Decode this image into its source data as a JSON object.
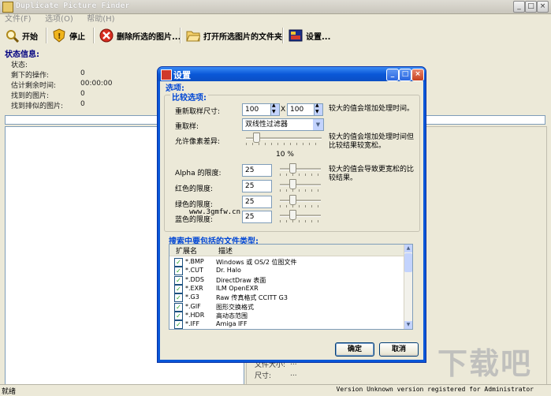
{
  "main": {
    "title": "Duplicate Picture Finder",
    "menu": [
      "文件(F)",
      "选项(O)",
      "帮助(H)"
    ],
    "toolbar": {
      "start": "开始",
      "stop": "停止",
      "delete_selected": "删除所选的图片...",
      "open_folder": "打开所选图片的文件夹",
      "settings": "设置..."
    },
    "status": {
      "header": "状态信息:",
      "rows": [
        {
          "label": "状态:",
          "value": ""
        },
        {
          "label": "剩下的操作:",
          "value": "0"
        },
        {
          "label": "估计剩余时间:",
          "value": "00:00:00"
        },
        {
          "label": "找到的图片:",
          "value": "0"
        },
        {
          "label": "找到排似的图片:",
          "value": "0"
        }
      ]
    },
    "right_pane": {
      "file_size_label": "文件大小:",
      "file_size_value": "...",
      "dims_label": "尺寸:",
      "dims_value": "..."
    },
    "statusbar": {
      "left": "就绪",
      "right": "Version Unknown version registered for Administrator"
    },
    "watermark": "下载吧"
  },
  "dialog": {
    "title": "设置",
    "section_options": "选项:",
    "compare_group": "比较选项:",
    "resample_size_label": "重新取样尺寸:",
    "resample_w": "100",
    "resample_x": "X",
    "resample_h": "100",
    "resample_note": "较大的值会增加处理时间。",
    "resample_label": "重取样:",
    "resample_filter": "双线性过滤器",
    "pixel_diff_label": "允许像素差异:",
    "pixel_diff_value": 0.1,
    "pixel_diff_text": "10 %",
    "pixel_diff_note": "较大的值会增加处理时间但比较结果较宽松。",
    "alpha_label": "Alpha 的限度:",
    "alpha_value": "25",
    "red_label": "红色的限度:",
    "red_value": "25",
    "green_label": "绿色的限度:",
    "green_value": "25",
    "blue_label": "蓝色的限度:",
    "blue_value": "25",
    "tolerance_note": "较大的值会导致更宽松的比较结果。",
    "site_text": "www.3gmfw.cn",
    "filetypes_label": "搜索中要包括的文件类型:",
    "col_ext": "扩展名",
    "col_desc": "描述",
    "file_types": [
      {
        "ext": "*.BMP",
        "desc": "Windows 或 OS/2 位图文件",
        "checked": true
      },
      {
        "ext": "*.CUT",
        "desc": "Dr. Halo",
        "checked": true
      },
      {
        "ext": "*.DDS",
        "desc": "DirectDraw 表面",
        "checked": true
      },
      {
        "ext": "*.EXR",
        "desc": "ILM OpenEXR",
        "checked": true
      },
      {
        "ext": "*.G3",
        "desc": "Raw 传真格式 CCITT G3",
        "checked": true
      },
      {
        "ext": "*.GIF",
        "desc": "图形交换格式",
        "checked": true
      },
      {
        "ext": "*.HDR",
        "desc": "高动态范围",
        "checked": true
      },
      {
        "ext": "*.IFF",
        "desc": "Amiga IFF",
        "checked": true
      }
    ],
    "ok": "确定",
    "cancel": "取消"
  }
}
